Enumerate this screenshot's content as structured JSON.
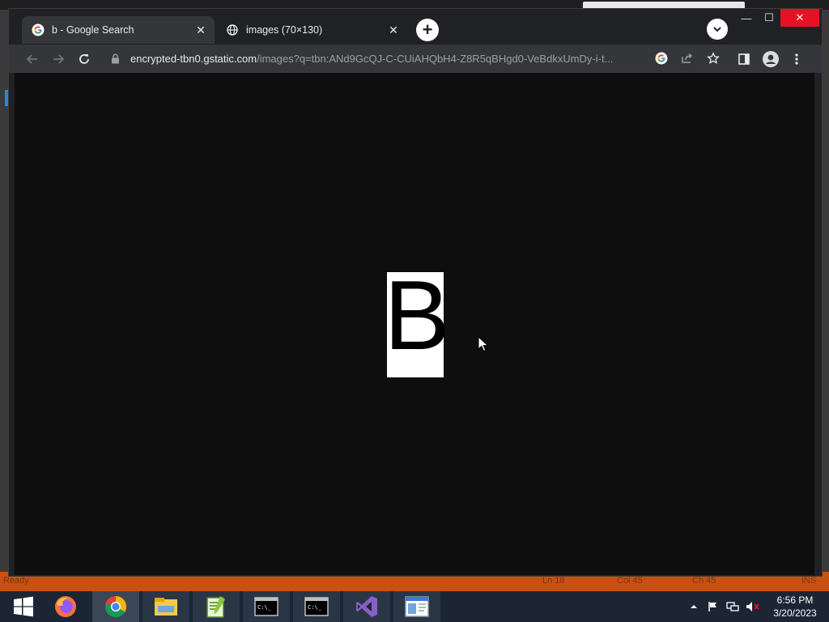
{
  "background_app": {
    "status_ready": "Ready",
    "status_line": "Ln 18",
    "status_col": "Col 45",
    "status_ch": "Ch 45",
    "status_ins": "INS"
  },
  "browser": {
    "tabs": [
      {
        "title": "b - Google Search",
        "icon": "google-g-icon",
        "active": true
      },
      {
        "title": "images (70×130)",
        "icon": "globe-icon",
        "active": false
      }
    ],
    "new_tab_label": "+",
    "address": {
      "host": "encrypted-tbn0.gstatic.com",
      "path": "/images?q=tbn:ANd9GcQJ-C-CUiAHQbH4-Z8R5qBHgd0-VeBdkxUmDy-i-t..."
    },
    "window_controls": {
      "minimize": "—",
      "maximize": "☐",
      "close": "✕"
    }
  },
  "page": {
    "image_letter": "B",
    "image_width": 70,
    "image_height": 130
  },
  "taskbar": {
    "items": [
      "start-icon",
      "firefox-icon",
      "chrome-icon",
      "file-explorer-icon",
      "notepad-plus-plus-icon",
      "cmd-icon",
      "cmd-icon",
      "visual-studio-icon",
      "app-window-icon"
    ],
    "time": "6:56 PM",
    "date": "3/20/2023"
  },
  "colors": {
    "accent_orange": "#ca5010",
    "close_red": "#e81123",
    "chrome_dark": "#202124",
    "chrome_toolbar": "#35363a",
    "viewport": "#0e0e0e"
  }
}
